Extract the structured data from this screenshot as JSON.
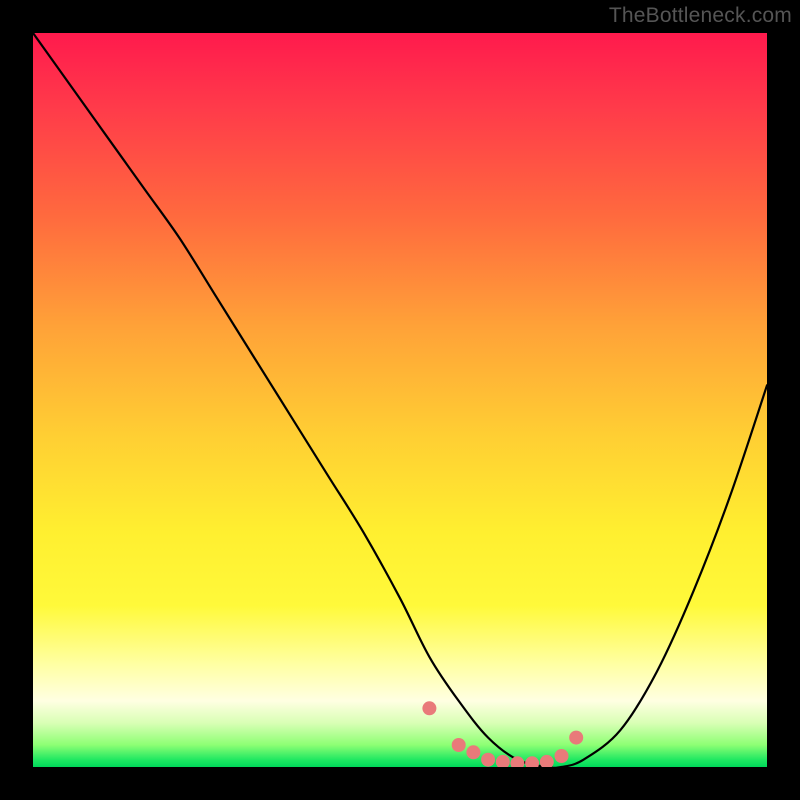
{
  "watermark": "TheBottleneck.com",
  "chart_data": {
    "type": "line",
    "title": "",
    "xlabel": "",
    "ylabel": "",
    "xlim": [
      0,
      100
    ],
    "ylim": [
      0,
      100
    ],
    "series": [
      {
        "name": "bottleneck-curve",
        "x": [
          0,
          5,
          10,
          15,
          20,
          25,
          30,
          35,
          40,
          45,
          50,
          54,
          58,
          62,
          66,
          70,
          72,
          75,
          80,
          85,
          90,
          95,
          100
        ],
        "y": [
          100,
          93,
          86,
          79,
          72,
          64,
          56,
          48,
          40,
          32,
          23,
          15,
          9,
          4,
          1,
          0,
          0,
          1,
          5,
          13,
          24,
          37,
          52
        ]
      }
    ],
    "markers": {
      "name": "highlight-dots",
      "color": "#e97a7a",
      "x": [
        54,
        58,
        60,
        62,
        64,
        66,
        68,
        70,
        72,
        74
      ],
      "y": [
        8,
        3,
        2,
        1,
        0.7,
        0.5,
        0.5,
        0.7,
        1.5,
        4
      ]
    },
    "gradient_stops": [
      {
        "pos": 0,
        "color": "#ff1a4d"
      },
      {
        "pos": 55,
        "color": "#ffcf33"
      },
      {
        "pos": 86,
        "color": "#ffffa3"
      },
      {
        "pos": 97,
        "color": "#8dff74"
      },
      {
        "pos": 100,
        "color": "#00d85a"
      }
    ]
  }
}
